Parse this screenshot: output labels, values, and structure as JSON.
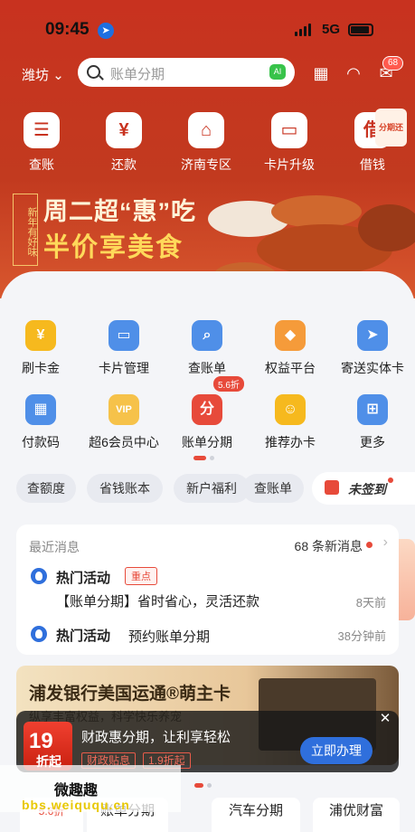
{
  "status": {
    "time": "09:45",
    "network": "5G"
  },
  "header": {
    "city": "潍坊",
    "search_placeholder": "账单分期",
    "ai_label": "AI",
    "message_count": "68"
  },
  "quick_actions": [
    {
      "label": "查账",
      "icon": "bill-icon"
    },
    {
      "label": "还款",
      "icon": "money-bag-icon"
    },
    {
      "label": "济南专区",
      "icon": "building-icon"
    },
    {
      "label": "卡片升级",
      "icon": "card-upgrade-icon"
    },
    {
      "label": "借钱",
      "icon": "borrow-icon",
      "tag": "分期还"
    }
  ],
  "banner": {
    "side_text": "新年有好味",
    "line1": "周二超“惠”吃",
    "line2": "半价享美食"
  },
  "services": [
    {
      "label": "刷卡金",
      "icon": "coin-icon",
      "color": "#f6b91e"
    },
    {
      "label": "卡片管理",
      "icon": "card-icon",
      "color": "#4f8fe8"
    },
    {
      "label": "查账单",
      "icon": "search-bill-icon",
      "color": "#4f8fe8"
    },
    {
      "label": "权益平台",
      "icon": "rights-icon",
      "color": "#f59b3a"
    },
    {
      "label": "寄送实体卡",
      "icon": "send-card-icon",
      "color": "#4f8fe8"
    },
    {
      "label": "付款码",
      "icon": "pay-code-icon",
      "color": "#4f8fe8"
    },
    {
      "label": "超6会员中心",
      "icon": "vip-icon",
      "color": "#f6c24a"
    },
    {
      "label": "账单分期",
      "icon": "installment-icon",
      "color": "#e74a3a",
      "tag": "5.6折"
    },
    {
      "label": "推荐办卡",
      "icon": "recommend-icon",
      "color": "#f6b91e"
    },
    {
      "label": "更多",
      "icon": "more-icon",
      "color": "#4f8fe8"
    }
  ],
  "chips": [
    "查额度",
    "省钱账本",
    "新户福利",
    "查账单"
  ],
  "sign_label": "未签到",
  "news": {
    "recent_label": "最近消息",
    "count_label": "68 条新消息",
    "item1_title": "热门活动",
    "item1_tag": "重点",
    "item1_text": "【账单分期】省时省心，灵活还款",
    "item1_time": "8天前",
    "item2_title": "热门活动",
    "item2_text": "预约账单分期",
    "item2_time": "38分钟前"
  },
  "promo": {
    "title": "浦发银行美国运通®萌主卡",
    "subtitle": "纵享丰富权益，科学快乐养宠"
  },
  "popup": {
    "badge_num": "19",
    "badge_sub": "折起",
    "text": "财政惠分期，让利享轻松",
    "tag1": "财政贴息",
    "tag2": "1.9折起",
    "button": "立即办理"
  },
  "watermark": {
    "line1": "微趣趣",
    "line2": "bbs.weiququ.cn"
  },
  "bottom_tabs": [
    "5.6折",
    "账单分期",
    "汽车分期",
    "浦优财富"
  ],
  "colors": {
    "brand_red": "#c8321f",
    "accent_blue": "#2f6fdc",
    "alert_red": "#e74a3a"
  }
}
